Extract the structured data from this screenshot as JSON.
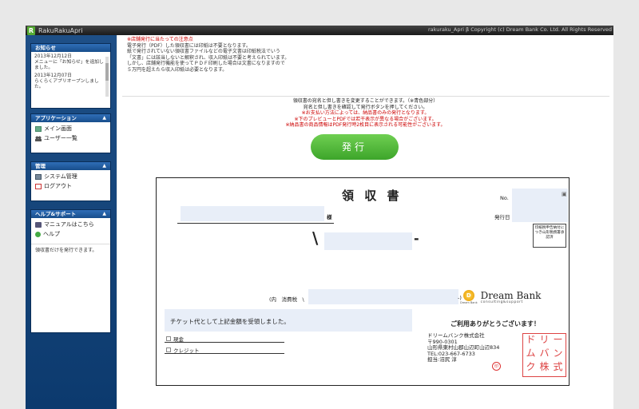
{
  "header": {
    "app_name": "RakuRakuApri",
    "logo_letter": "R",
    "copyright": "rakuraku_Apri β Copyright (c) Dream Bank Co. Ltd. All Rights Reserved"
  },
  "sidebar": {
    "news": {
      "title": "お知らせ",
      "items": [
        {
          "date": "2013年12月12日",
          "text": "メニューに「お知らせ」を追加しました。"
        },
        {
          "date": "2013年12月07日",
          "text": "らくらくアプリオープンしました。"
        }
      ]
    },
    "app": {
      "title": "アプリケーション",
      "items": [
        {
          "label": "メイン画面"
        },
        {
          "label": "ユーザー一覧"
        }
      ]
    },
    "admin": {
      "title": "管理",
      "items": [
        {
          "label": "システム管理"
        },
        {
          "label": "ログアウト"
        }
      ]
    },
    "help": {
      "title": "ヘルプ&サポート",
      "items": [
        {
          "label": "マニュアルはこちら"
        },
        {
          "label": "ヘルプ"
        }
      ],
      "note": "領収書だけを発行できます。"
    }
  },
  "notice": {
    "title": "※店舗発行に当たっての注意点",
    "lines": [
      "電子発行（PDF）した領収書には印紙は不要となります。",
      "紙で発行されていない領収書ファイルなどの電子文書は印紙税法でいう",
      "「文書」には該当しないと解釈され、収入印紙は不要と考えられています。",
      "しかし、店舗発行機能を使ってＰＤＦ印刷した場合は文書になりますので",
      "５万円を超えたら収入印紙は必要となります。"
    ]
  },
  "instructions": {
    "lines": [
      "領収書の宛名と但し書きを変更することができます。（※青色部分）",
      "宛名と但し書きを確認して発行ボタンを押してください。"
    ],
    "warnings": [
      "※お支払い方法によっては、納品書のみの発行となります。",
      "※下のプレビューとPDFでは若干表示が異なる場合がございます。",
      "※納品書の商品情報はPDF発行時2枚目に表示される可能性がございます。"
    ]
  },
  "issue_button": {
    "label": "発行"
  },
  "receipt": {
    "title": "領 収 書",
    "no_label": "No.",
    "sama": "様",
    "issue_date_label": "発行日",
    "yen": "\\",
    "dash": "-",
    "tax_prefix": "(内　消費税　\\",
    "tax_suffix": "-)",
    "stamp_note": "印紙税申告納付につき山形税務署承認済",
    "description": "チケット代として上記金額を受領しました。",
    "payment_methods": [
      {
        "label": "現金"
      },
      {
        "label": "クレジット"
      }
    ],
    "brand": {
      "mark": "D",
      "name": "Dream Bank",
      "sub": "consulting&support",
      "mark_sub": "Dream Bank"
    },
    "thanks": "ご利用ありがとうございます！",
    "company": [
      "ドリームバンク株式会社",
      "〒990-0301",
      "山形県東村山郡山辺町山辺834",
      "TEL:023-667-6733",
      "担当:沼尻 淳"
    ],
    "seal_text": [
      "ド",
      "リ",
      "ー",
      "ム",
      "バ",
      "ン",
      "ク",
      "株",
      "式"
    ],
    "seal_small": "印"
  },
  "colors": {
    "accent": "#1e4f86",
    "button": "#4cb636",
    "editable": "#e8eef8",
    "warning": "#cc0000",
    "seal": "#dd4444"
  }
}
